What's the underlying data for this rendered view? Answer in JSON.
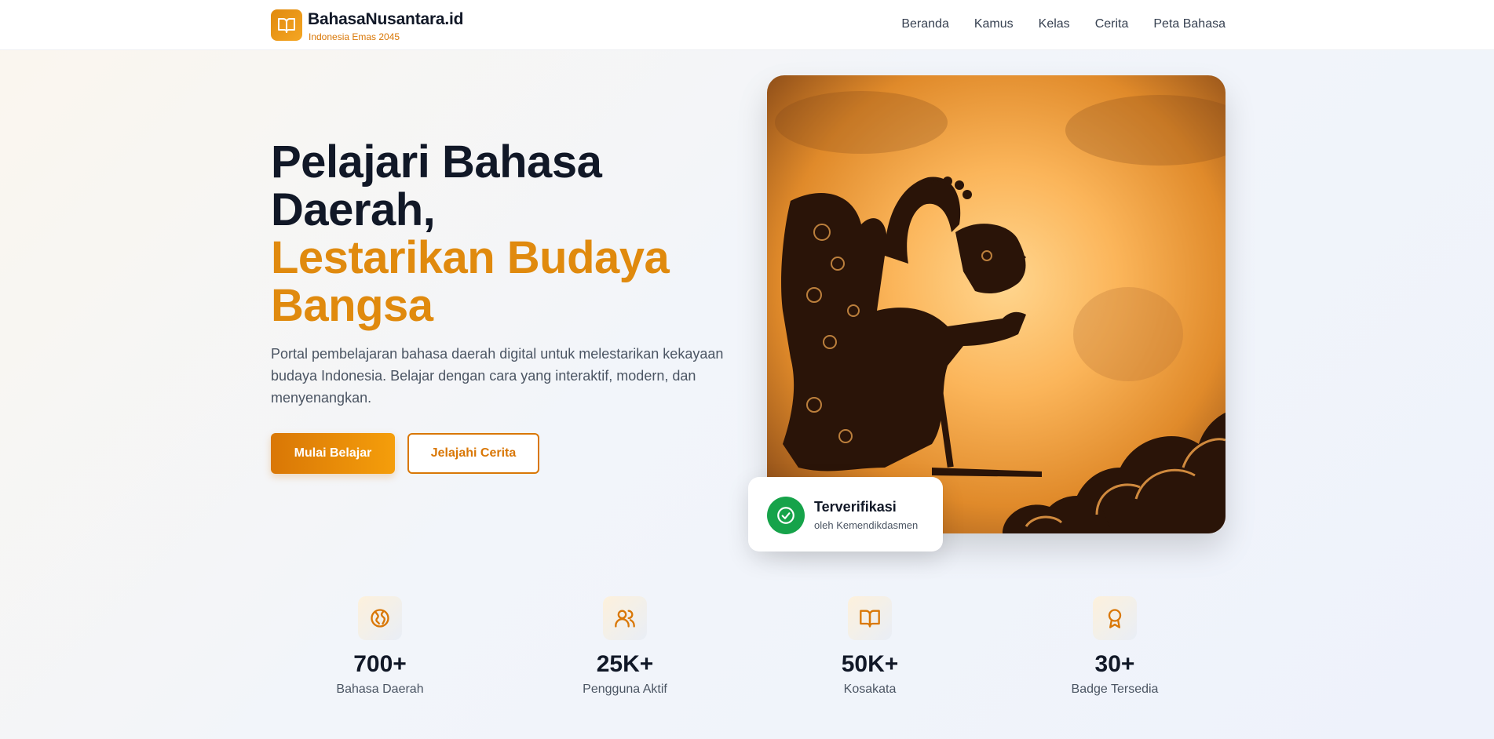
{
  "header": {
    "brand_name": "BahasaNusantara.id",
    "brand_tagline": "Indonesia Emas 2045",
    "nav": [
      "Beranda",
      "Kamus",
      "Kelas",
      "Cerita",
      "Peta Bahasa"
    ]
  },
  "hero": {
    "title_line1": "Pelajari Bahasa",
    "title_line2": "Daerah,",
    "title_accent1": "Lestarikan Budaya",
    "title_accent2": "Bangsa",
    "description": "Portal pembelajaran bahasa daerah digital untuk melestarikan kekayaan budaya Indonesia. Belajar dengan cara yang interaktif, modern, dan menyenangkan.",
    "primary_button": "Mulai Belajar",
    "secondary_button": "Jelajahi Cerita",
    "image_icon": "wayang-silhouette-image"
  },
  "verified": {
    "title": "Terverifikasi",
    "subtitle": "oleh Kemendikdasmen",
    "icon": "check-circle-icon"
  },
  "stats": [
    {
      "value": "700+",
      "label": "Bahasa Daerah",
      "icon": "globe-icon"
    },
    {
      "value": "25K+",
      "label": "Pengguna Aktif",
      "icon": "users-icon"
    },
    {
      "value": "50K+",
      "label": "Kosakata",
      "icon": "book-open-icon"
    },
    {
      "value": "30+",
      "label": "Badge Tersedia",
      "icon": "award-icon"
    }
  ],
  "colors": {
    "accent": "#e08a0e",
    "accent_light": "#f59e0b",
    "text_dark": "#111827",
    "verified_green": "#16a34a"
  }
}
